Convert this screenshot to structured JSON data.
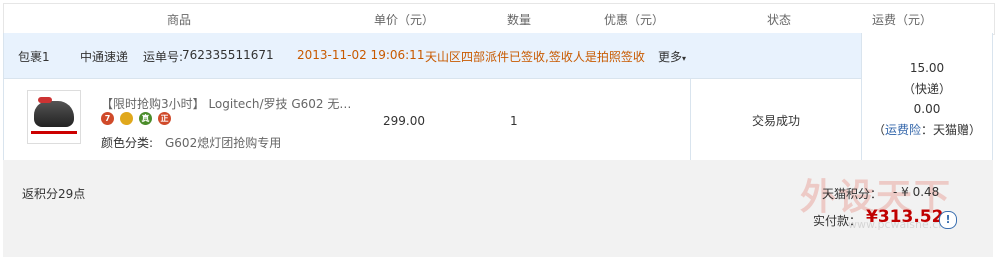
{
  "header": {
    "col_product": "商品",
    "col_price": "单价（元）",
    "col_qty": "数量",
    "col_discount": "优惠（元）",
    "col_status": "状态",
    "col_shipping": "运费（元）"
  },
  "package": {
    "name": "包裹1",
    "carrier": "中通速递",
    "tracking_label": "运单号:",
    "tracking_no": "762335511671",
    "timestamp": "2013-11-02 19:06:11",
    "event": "天山区四部派件已签收,签收人是拍照签收",
    "more_label": "更多"
  },
  "item": {
    "title": "【限时抢购3小时】 Logitech/罗技 G602 无…",
    "badges": [
      "7",
      "",
      "真",
      "正"
    ],
    "color_label": "颜色分类:",
    "color_value": "G602熄灯团抢购专用",
    "price": "299.00",
    "qty": "1",
    "status": "交易成功"
  },
  "shipping": {
    "fee": "15.00",
    "method": "（快递）",
    "insurance_fee": "0.00",
    "insurance_prefix": "（",
    "insurance_label": "运费险",
    "insurance_suffix": "：天猫赠）"
  },
  "footer": {
    "points_return": "返积分29点",
    "tmall_points_label": "天猫积分：",
    "tmall_points_value": "- ¥ 0.48",
    "paid_label": "实付款：",
    "paid_value": "¥313.52",
    "watermark": "外设天下",
    "watermark_site": "www.pcwaishe.cn"
  },
  "colors": {
    "accent_red": "#c00000",
    "orange": "#c85a00",
    "link_blue": "#3366aa",
    "package_bar": "#e8f2fd"
  }
}
